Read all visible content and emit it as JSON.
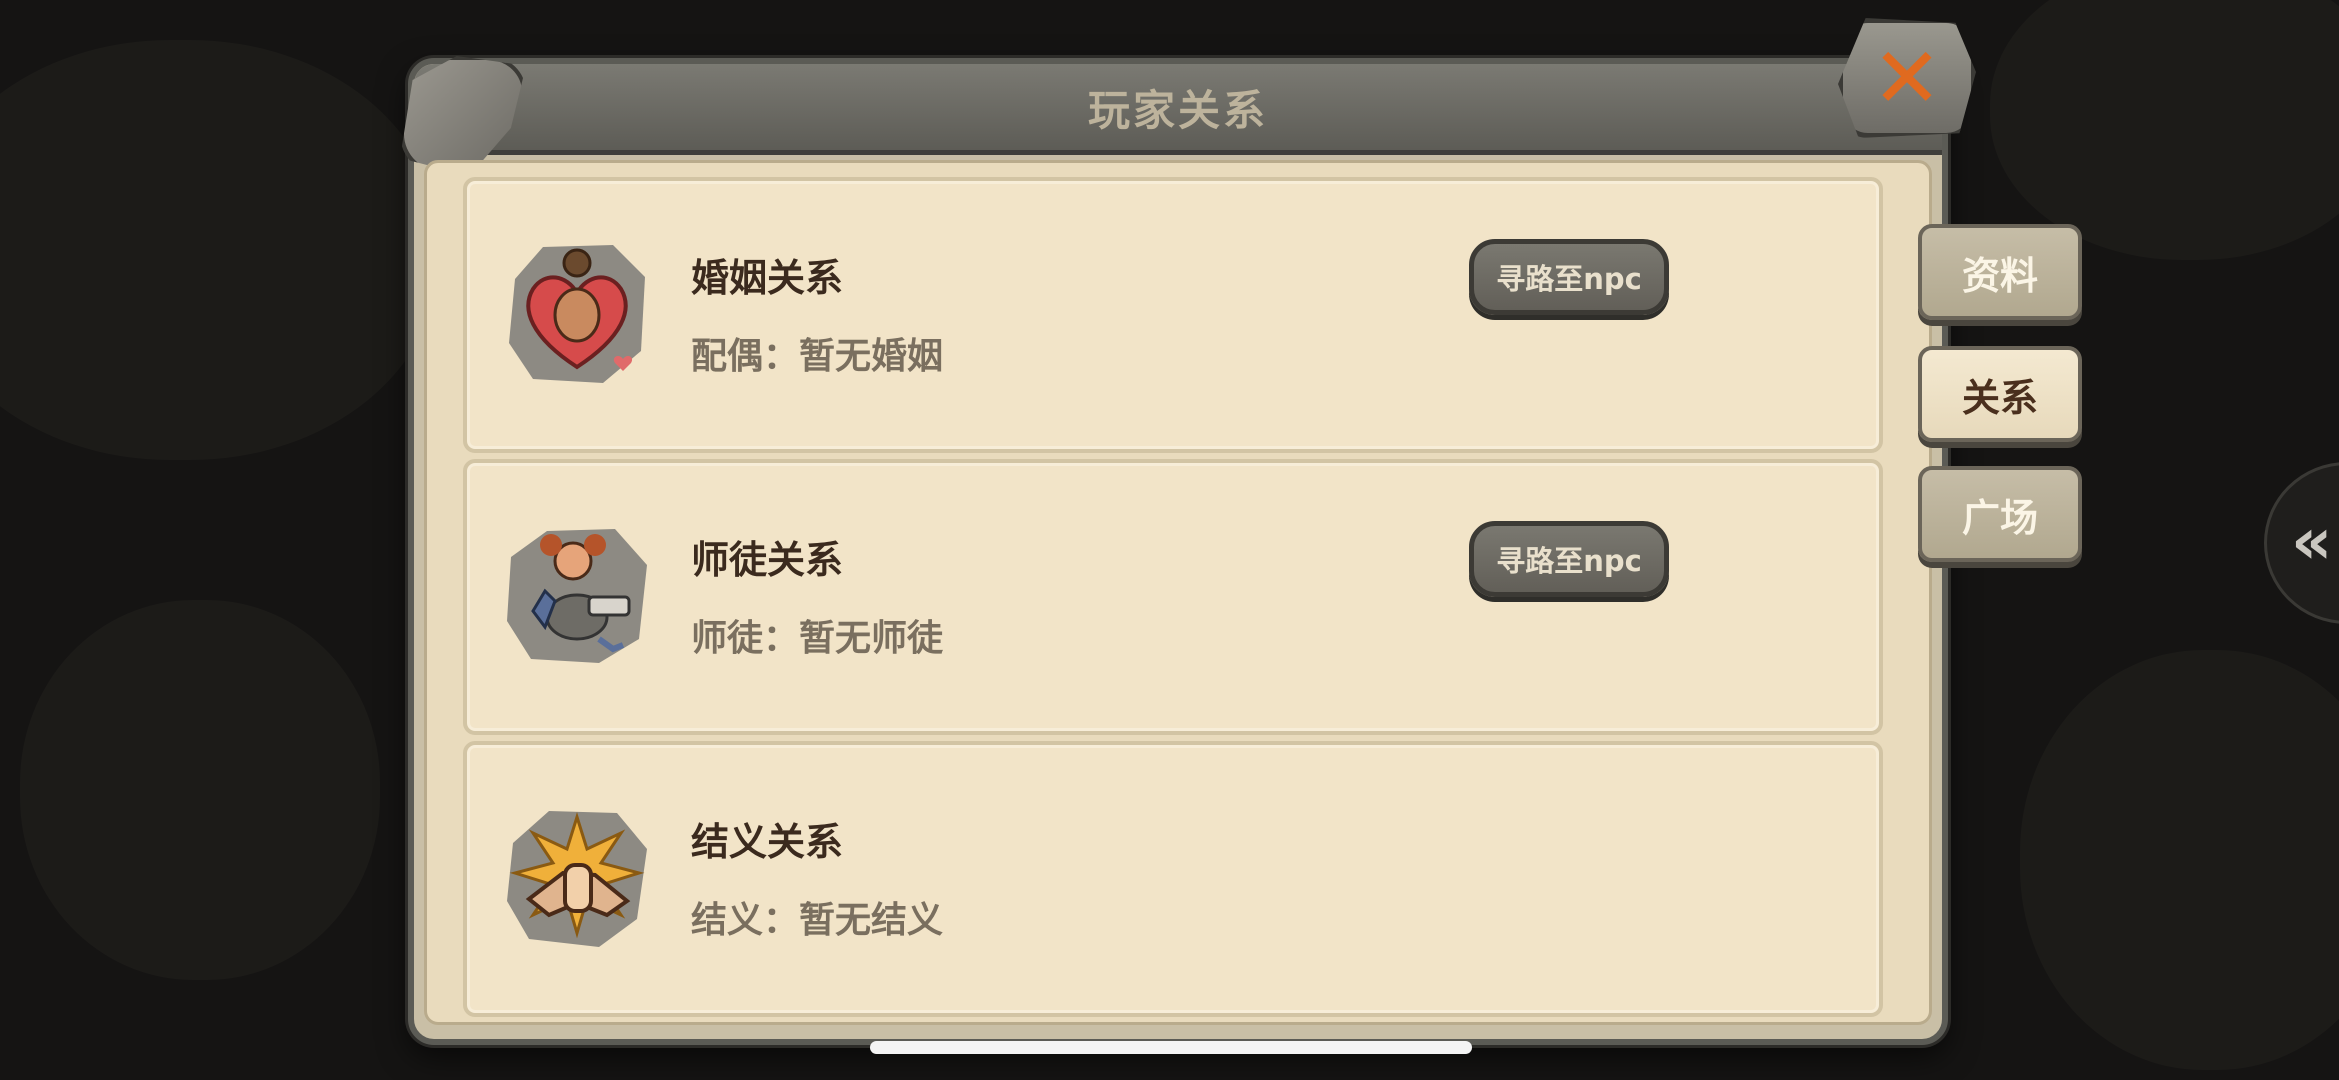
{
  "window": {
    "title": "玩家关系"
  },
  "relations": [
    {
      "title": "婚姻关系",
      "subtitle": "配偶：暂无婚姻",
      "action_label": "寻路至npc",
      "icon": "heart-couple-icon"
    },
    {
      "title": "师徒关系",
      "subtitle": "师徒：暂无师徒",
      "action_label": "寻路至npc",
      "icon": "master-apprentice-icon"
    },
    {
      "title": "结义关系",
      "subtitle": "结义：暂无结义",
      "icon": "handshake-icon"
    }
  ],
  "tabs": [
    {
      "label": "资料",
      "active": false
    },
    {
      "label": "关系",
      "active": true
    },
    {
      "label": "广场",
      "active": false
    }
  ],
  "close": {
    "glyph": "✕"
  },
  "side_handle": {
    "glyph": "«"
  },
  "colors": {
    "accent_close": "#e06a1f",
    "card_bg": "#f2e4c8",
    "title_text": "#3b2a1e"
  }
}
